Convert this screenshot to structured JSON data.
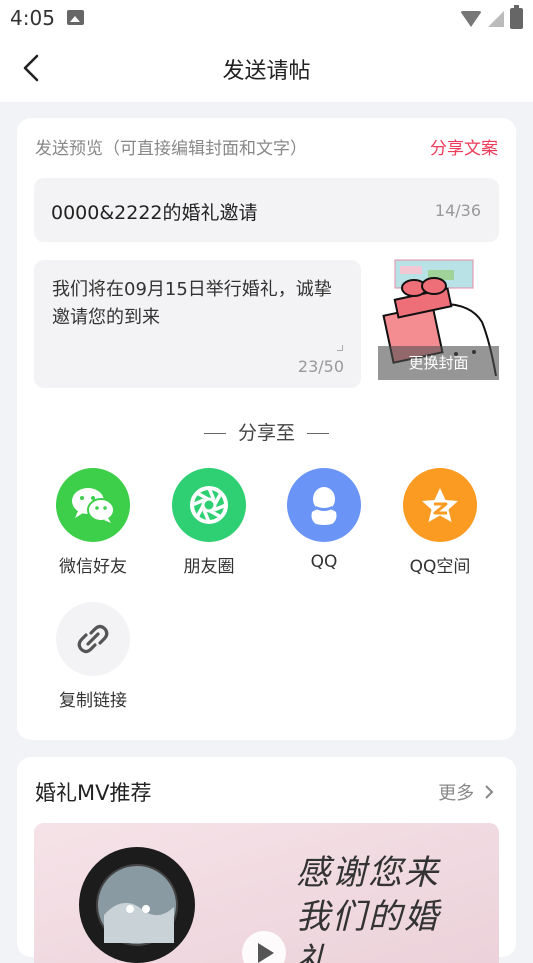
{
  "status_bar": {
    "time": "4:05"
  },
  "header": {
    "title": "发送请帖"
  },
  "preview": {
    "hint": "发送预览（可直接编辑封面和文字）",
    "share_copy_link": "分享文案",
    "title_value": "0000&2222的婚礼邀请",
    "title_count": "14/36",
    "message_value": "我们将在09月15日举行婚礼，诚挚邀请您的到来",
    "message_count": "23/50",
    "change_cover_label": "更换封面"
  },
  "share": {
    "heading": "分享至",
    "targets": [
      {
        "label": "微信好友",
        "icon": "wechat-icon",
        "color": "#3dcf4a"
      },
      {
        "label": "朋友圈",
        "icon": "moments-icon",
        "color": "#2fcf73"
      },
      {
        "label": "QQ",
        "icon": "qq-icon",
        "color": "#5a8cf7"
      },
      {
        "label": "QQ空间",
        "icon": "qzone-icon",
        "color": "#fb9b22"
      },
      {
        "label": "复制链接",
        "icon": "link-icon",
        "color": "#f3f3f5"
      }
    ]
  },
  "mv": {
    "title": "婚礼MV推荐",
    "more_label": "更多",
    "thumbnail_caption": "感谢您来我们的婚礼"
  }
}
